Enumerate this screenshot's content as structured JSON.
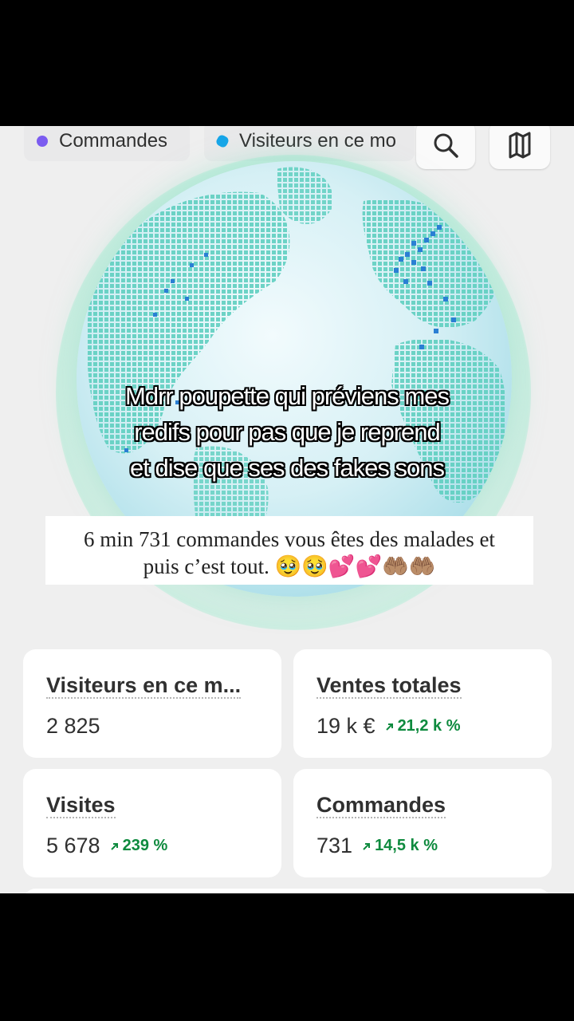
{
  "filters": {
    "orders_label": "Commandes",
    "visitors_label": "Visiteurs en ce mo"
  },
  "icons": {
    "search": "search-icon",
    "map": "map-icon"
  },
  "overlay": {
    "caption_lines": [
      "Mdrr poupette qui préviens mes",
      "redifs pour pas que je reprend",
      "et dise que ses des fakes sons"
    ],
    "note_line1": "6 min 731 commandes vous êtes des malades et",
    "note_line2": "puis c’est tout. 🥹🥹💕💕🤲🏽🤲🏽"
  },
  "metrics": [
    {
      "title": "Visiteurs en ce m...",
      "value": "2 825",
      "trend": ""
    },
    {
      "title": "Ventes totales",
      "value": "19 k €",
      "trend": "21,2 k %"
    },
    {
      "title": "Visites",
      "value": "5 678",
      "trend": "239 %"
    },
    {
      "title": "Commandes",
      "value": "731",
      "trend": "14,5 k %"
    }
  ],
  "colors": {
    "trend_green": "#0e8a3e",
    "orders_dot": "#7b5cf0",
    "visitors_dot": "#16a5e8",
    "globe_land": "#5fcfc0",
    "activity_blue": "#2a7fd4"
  }
}
